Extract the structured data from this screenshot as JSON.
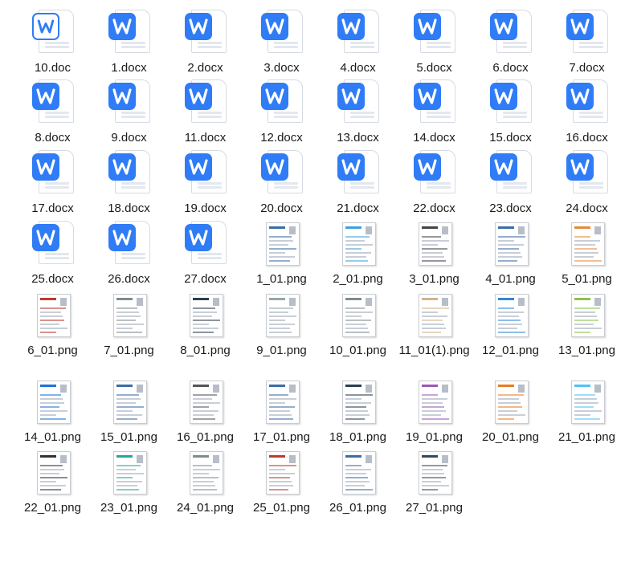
{
  "files": [
    {
      "name": "10.doc",
      "type": "doc",
      "style": "outline"
    },
    {
      "name": "1.docx",
      "type": "doc"
    },
    {
      "name": "2.docx",
      "type": "doc"
    },
    {
      "name": "3.docx",
      "type": "doc"
    },
    {
      "name": "4.docx",
      "type": "doc"
    },
    {
      "name": "5.docx",
      "type": "doc"
    },
    {
      "name": "6.docx",
      "type": "doc"
    },
    {
      "name": "7.docx",
      "type": "doc"
    },
    {
      "name": "8.docx",
      "type": "doc"
    },
    {
      "name": "9.docx",
      "type": "doc"
    },
    {
      "name": "11.docx",
      "type": "doc"
    },
    {
      "name": "12.docx",
      "type": "doc"
    },
    {
      "name": "13.docx",
      "type": "doc"
    },
    {
      "name": "14.docx",
      "type": "doc"
    },
    {
      "name": "15.docx",
      "type": "doc"
    },
    {
      "name": "16.docx",
      "type": "doc"
    },
    {
      "name": "17.docx",
      "type": "doc"
    },
    {
      "name": "18.docx",
      "type": "doc"
    },
    {
      "name": "19.docx",
      "type": "doc"
    },
    {
      "name": "20.docx",
      "type": "doc"
    },
    {
      "name": "21.docx",
      "type": "doc"
    },
    {
      "name": "22.docx",
      "type": "doc"
    },
    {
      "name": "23.docx",
      "type": "doc"
    },
    {
      "name": "24.docx",
      "type": "doc"
    },
    {
      "name": "25.docx",
      "type": "doc"
    },
    {
      "name": "26.docx",
      "type": "doc"
    },
    {
      "name": "27.docx",
      "type": "doc"
    },
    {
      "name": "1_01.png",
      "type": "png",
      "accent": "#3a6ea5"
    },
    {
      "name": "2_01.png",
      "type": "png",
      "accent": "#3fa1d9"
    },
    {
      "name": "3_01.png",
      "type": "png",
      "accent": "#444444"
    },
    {
      "name": "4_01.png",
      "type": "png",
      "accent": "#3a6ea5"
    },
    {
      "name": "5_01.png",
      "type": "png",
      "accent": "#e58a3a"
    },
    {
      "name": "6_01.png",
      "type": "png",
      "accent": "#c0392b"
    },
    {
      "name": "7_01.png",
      "type": "png",
      "accent": "#7f8c8d"
    },
    {
      "name": "8_01.png",
      "type": "png",
      "accent": "#2c3e50"
    },
    {
      "name": "9_01.png",
      "type": "png",
      "accent": "#95a5a6"
    },
    {
      "name": "10_01.png",
      "type": "png",
      "accent": "#7f8c8d"
    },
    {
      "name": "11_01(1).png",
      "type": "png",
      "accent": "#d4b38a"
    },
    {
      "name": "12_01.png",
      "type": "png",
      "accent": "#2e86de"
    },
    {
      "name": "13_01.png",
      "type": "png",
      "accent": "#8bc34a"
    },
    {
      "name": "14_01.png",
      "type": "png",
      "accent": "#1e73d8"
    },
    {
      "name": "15_01.png",
      "type": "png",
      "accent": "#3a6ea5"
    },
    {
      "name": "16_01.png",
      "type": "png",
      "accent": "#555555"
    },
    {
      "name": "17_01.png",
      "type": "png",
      "accent": "#3a6ea5"
    },
    {
      "name": "18_01.png",
      "type": "png",
      "accent": "#2c3e50"
    },
    {
      "name": "19_01.png",
      "type": "png",
      "accent": "#9b59b6"
    },
    {
      "name": "20_01.png",
      "type": "png",
      "accent": "#e67e22"
    },
    {
      "name": "21_01.png",
      "type": "png",
      "accent": "#4fc3f7"
    },
    {
      "name": "22_01.png",
      "type": "png",
      "accent": "#333333"
    },
    {
      "name": "23_01.png",
      "type": "png",
      "accent": "#26a69a"
    },
    {
      "name": "24_01.png",
      "type": "png",
      "accent": "#7f8c8d"
    },
    {
      "name": "25_01.png",
      "type": "png",
      "accent": "#c0392b"
    },
    {
      "name": "26_01.png",
      "type": "png",
      "accent": "#3a6ea5"
    },
    {
      "name": "27_01.png",
      "type": "png",
      "accent": "#34495e"
    }
  ]
}
